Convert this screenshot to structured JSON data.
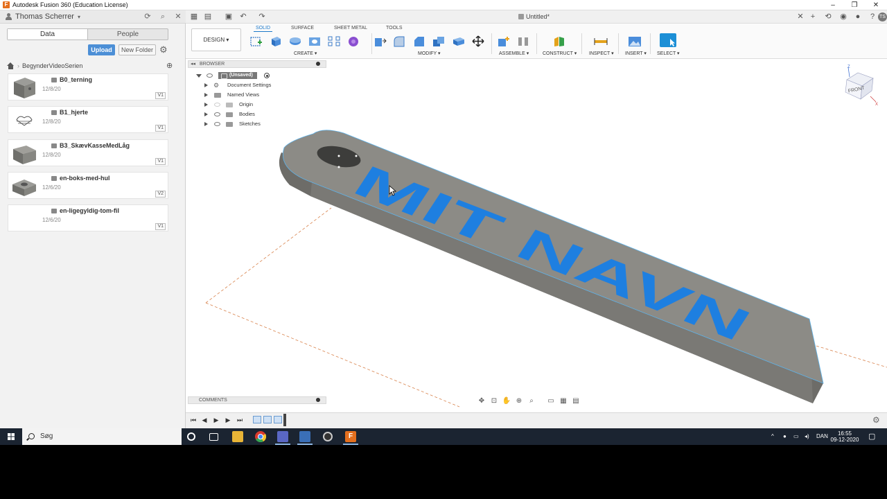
{
  "window": {
    "title": "Autodesk Fusion 360 (Education License)",
    "controls": [
      "–",
      "❐",
      "✕"
    ]
  },
  "data_panel": {
    "user": "Thomas Scherrer",
    "tabs": [
      "Data",
      "People"
    ],
    "upload_label": "Upload",
    "new_folder_label": "New Folder",
    "breadcrumb": "BegynderVideoSerien",
    "files": [
      {
        "name": "B0_terning",
        "date": "12/8/20",
        "version": "V1"
      },
      {
        "name": "B1_hjerte",
        "date": "12/8/20",
        "version": "V1"
      },
      {
        "name": "B3_SkævKasseMedLåg",
        "date": "12/8/20",
        "version": "V1"
      },
      {
        "name": "en-boks-med-hul",
        "date": "12/6/20",
        "version": "V2"
      },
      {
        "name": "en-ligegyldig-tom-fil",
        "date": "12/6/20",
        "version": "V1"
      }
    ]
  },
  "document": {
    "tab_title": "Untitled*",
    "user_initials": "TS"
  },
  "ribbon": {
    "workspace": "DESIGN",
    "tabs": [
      "SOLID",
      "SURFACE",
      "SHEET METAL",
      "TOOLS"
    ],
    "groups": [
      "CREATE",
      "MODIFY",
      "ASSEMBLE",
      "CONSTRUCT",
      "INSPECT",
      "INSERT",
      "SELECT"
    ]
  },
  "browser": {
    "header": "BROWSER",
    "root": "(Unsaved)",
    "items": [
      "Document Settings",
      "Named Views",
      "Origin",
      "Bodies",
      "Sketches"
    ]
  },
  "model": {
    "text": "MIT NAVN",
    "body_color": "#8c8b86",
    "text_color": "#1e7fe0"
  },
  "comments": {
    "label": "COMMENTS"
  },
  "viewcube": {
    "face": "FRONT",
    "axis_z": "Z",
    "axis_x": "X"
  },
  "taskbar": {
    "search_placeholder": "Søg",
    "language": "DAN",
    "time": "16:55",
    "date": "09-12-2020"
  },
  "colors": {
    "accent": "#1c78c9",
    "upload_button": "#4c8fd6",
    "taskbar": "#1b2431",
    "fusion_orange": "#e46f1e"
  }
}
